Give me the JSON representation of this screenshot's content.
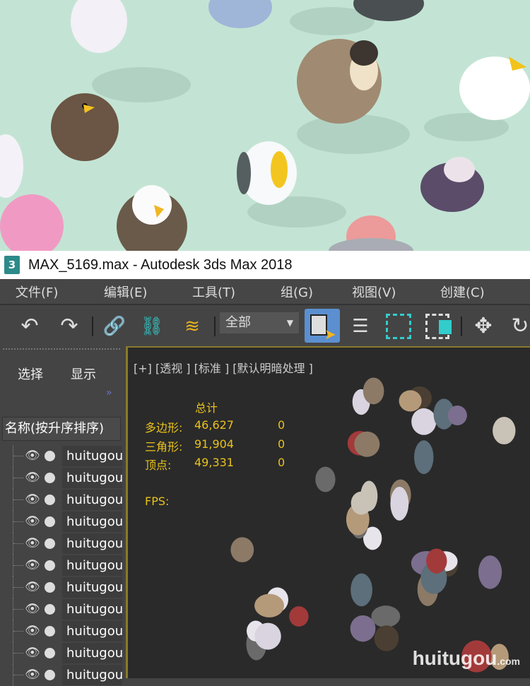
{
  "window": {
    "title": "MAX_5169.max - Autodesk 3ds Max 2018",
    "icon_text": "3"
  },
  "menu": [
    "文件(F)",
    "编辑(E)",
    "工具(T)",
    "组(G)",
    "视图(V)",
    "创建(C)"
  ],
  "toolbar": {
    "undo": "undo-icon",
    "redo": "redo-icon",
    "link": "link-icon",
    "unlink": "unlink-icon",
    "bind": "bind-space-warp-icon",
    "selection_filter": "全部",
    "select": "select-object-icon",
    "select_by_name": "select-by-name-icon",
    "rect_region": "rect-selection-icon",
    "window_crossing": "window-crossing-icon",
    "move": "move-icon",
    "rotate": "rotate-icon"
  },
  "scene_explorer": {
    "tab_select": "选择",
    "tab_display": "显示",
    "expand": "»",
    "sort_header": "名称(按升序排序)",
    "rows": [
      "huitugou",
      "huitugou",
      "huitugou",
      "huitugou",
      "huitugou",
      "huitugou",
      "huitugou",
      "huitugou",
      "huitugou",
      "huitugou",
      "huitugou"
    ]
  },
  "viewport": {
    "label": "[+] [透视 ] [标准 ] [默认明暗处理 ]",
    "stats": {
      "header": "总计",
      "polys_label": "多边形:",
      "polys": "46,627",
      "polys_sel": "0",
      "tris_label": "三角形:",
      "tris": "91,904",
      "tris_sel": "0",
      "verts_label": "顶点:",
      "verts": "49,331",
      "verts_sel": "0",
      "fps_label": "FPS:"
    }
  },
  "watermark": {
    "text": "huitugou",
    "suffix": ".com"
  }
}
